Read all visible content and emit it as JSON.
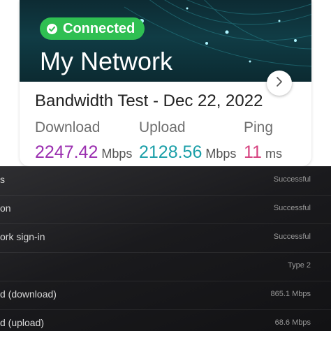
{
  "network": {
    "status": "Connected",
    "name": "My Network"
  },
  "test": {
    "title": "Bandwidth Test - Dec 22, 2022",
    "download": {
      "label": "Download",
      "value": "2247.42",
      "unit": "Mbps",
      "color": "#9b2fb0"
    },
    "upload": {
      "label": "Upload",
      "value": "2128.56",
      "unit": "Mbps",
      "color": "#1b9fa8"
    },
    "ping": {
      "label": "Ping",
      "value": "11",
      "unit": "ms",
      "color": "#d6417f"
    }
  },
  "settings": {
    "rows": [
      {
        "label": "s",
        "value": "Successful"
      },
      {
        "label": "on",
        "value": "Successful"
      },
      {
        "label": "ork sign-in",
        "value": "Successful"
      },
      {
        "label": "",
        "value": "Type 2"
      },
      {
        "label": "d (download)",
        "value": "865.1 Mbps"
      },
      {
        "label": "d (upload)",
        "value": "68.6 Mbps"
      }
    ]
  },
  "icons": {
    "status": "check-circle-icon",
    "next": "chevron-right-icon"
  }
}
